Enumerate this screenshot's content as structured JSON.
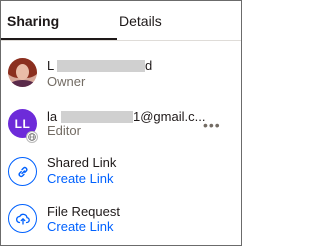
{
  "tabs": {
    "sharing": "Sharing",
    "details": "Details"
  },
  "members": [
    {
      "name_start": "L",
      "name_end": "d",
      "role": "Owner",
      "avatar": "photo"
    },
    {
      "name_start": "la",
      "name_end": "1@gmail.c...",
      "role": "Editor",
      "initials": "LL",
      "badge_icon": "globe-icon",
      "more": "•••"
    }
  ],
  "actions": [
    {
      "title": "Shared Link",
      "link": "Create Link",
      "icon": "link-icon"
    },
    {
      "title": "File Request",
      "link": "Create Link",
      "icon": "upload-icon"
    }
  ],
  "colors": {
    "accent": "#0061fe",
    "avatar_bg": "#6d2bd9",
    "text": "#1e1919",
    "muted": "#736c64"
  }
}
